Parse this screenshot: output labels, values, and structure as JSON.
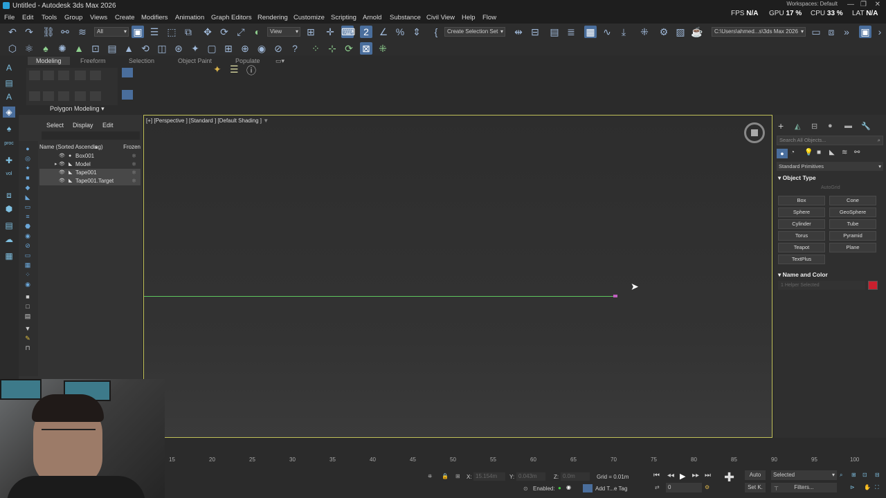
{
  "app": {
    "title": "Untitled - Autodesk 3ds Max 2026",
    "stats": {
      "fps_label": "FPS",
      "fps": "N/A",
      "gpu_label": "GPU",
      "gpu": "17 %",
      "cpu_label": "CPU",
      "cpu": "33 %",
      "lat_label": "LAT",
      "lat": "N/A"
    },
    "workspace": "Workspaces: Default"
  },
  "menu": [
    "File",
    "Edit",
    "Tools",
    "Group",
    "Views",
    "Create",
    "Modifiers",
    "Animation",
    "Graph Editors",
    "Rendering",
    "Customize",
    "Scripting",
    "Arnold",
    "Substance",
    "Civil View",
    "Help",
    "Flow"
  ],
  "toolbar": {
    "selection_filter": "All",
    "ref_coord": "View",
    "selection_set": "Create Selection Set",
    "project_path": "C:\\Users\\ahmed...s\\3ds Max 2026"
  },
  "ribbon": {
    "tabs": [
      "Modeling",
      "Freeform",
      "Selection",
      "Object Paint",
      "Populate"
    ],
    "active_tab": "Modeling",
    "panel_label": "Polygon Modeling"
  },
  "scene_explorer": {
    "tabs": [
      "Select",
      "Display",
      "Edit"
    ],
    "header_name": "Name (Sorted Ascending)",
    "header_frozen": "Frozen",
    "rows": [
      {
        "label": "Box001",
        "selected": false
      },
      {
        "label": "Model",
        "selected": false
      },
      {
        "label": "Tape001",
        "selected": true
      },
      {
        "label": "Tape001.Target",
        "selected": true
      }
    ]
  },
  "viewport": {
    "label": "[+] [Perspective ] [Standard ] [Default Shading ]"
  },
  "command_panel": {
    "search_placeholder": "Search All Objects...",
    "category": "Standard Primitives",
    "object_type_title": "Object Type",
    "autogrid_label": "AutoGrid",
    "buttons": [
      "Box",
      "Cone",
      "Sphere",
      "GeoSphere",
      "Cylinder",
      "Tube",
      "Torus",
      "Pyramid",
      "Teapot",
      "Plane",
      "TextPlus"
    ],
    "name_color_title": "Name and Color",
    "name_value": "1 Helper Selected",
    "color": "#c8202e"
  },
  "timeline": {
    "ticks": [
      "15",
      "20",
      "25",
      "30",
      "35",
      "40",
      "45",
      "50",
      "55",
      "60",
      "65",
      "70",
      "75",
      "80",
      "85",
      "90",
      "95",
      "100"
    ]
  },
  "status": {
    "x_label": "X:",
    "x_value": "15.154m",
    "y_label": "Y:",
    "y_value": "0.043m",
    "z_label": "Z:",
    "z_value": "0.0m",
    "grid": "Grid = 0.01m",
    "enabled_label": "Enabled:",
    "add_tag": "Add T...e Tag",
    "auto_label": "Auto",
    "set_key_label": "Set K.",
    "selected_dropdown": "Selected",
    "filters_label": "Filters...",
    "frame_value": "0"
  },
  "colors": {
    "accent": "#4a6e9c",
    "viewport_border": "#c2c25a",
    "horizon": "#5fc85f"
  }
}
